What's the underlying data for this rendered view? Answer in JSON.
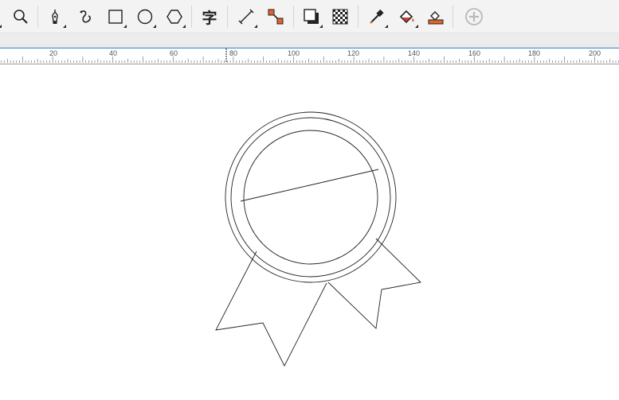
{
  "toolbar": {
    "tools": [
      {
        "name": "zoom-tool"
      },
      {
        "name": "pen-tool"
      },
      {
        "name": "bspline-tool"
      },
      {
        "name": "rectangle-tool"
      },
      {
        "name": "ellipse-tool"
      },
      {
        "name": "polygon-tool"
      },
      {
        "name": "text-tool",
        "glyph": "字"
      },
      {
        "name": "dimension-tool"
      },
      {
        "name": "connector-tool"
      },
      {
        "name": "drop-shadow-tool"
      },
      {
        "name": "transparency-tool"
      },
      {
        "name": "eyedropper-tool"
      },
      {
        "name": "interactive-fill-tool"
      },
      {
        "name": "smart-fill-tool"
      },
      {
        "name": "add-tool"
      }
    ],
    "accent_color": "#e0642a",
    "red_color": "#e03a2e"
  },
  "ruler": {
    "labels": [
      "20",
      "40",
      "60",
      "80",
      "100",
      "120",
      "140",
      "160",
      "180",
      "200"
    ],
    "accent": "#3c8fd8"
  }
}
